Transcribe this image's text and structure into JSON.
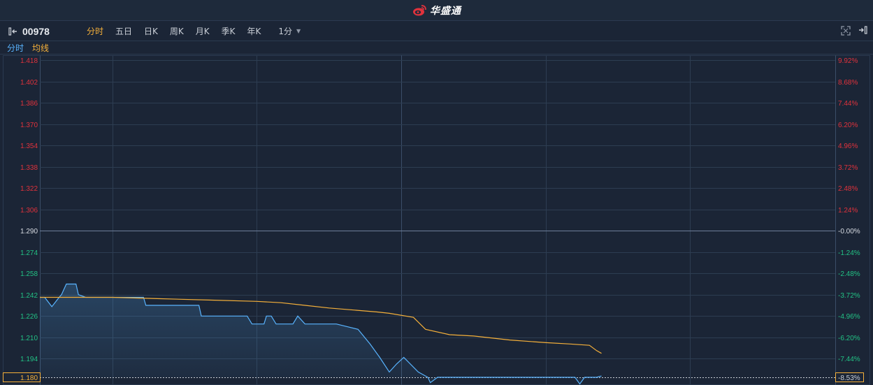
{
  "header": {
    "logo_text": "华盛通",
    "logo_icon": "sina-eye-icon"
  },
  "toolbar": {
    "stock_code": "00978",
    "tabs": [
      "分时",
      "五日",
      "日K",
      "周K",
      "月K",
      "季K",
      "年K"
    ],
    "active_tab": "分时",
    "period": "1分"
  },
  "legend": {
    "price_label": "分时",
    "avg_label": "均线"
  },
  "colors": {
    "up": "#e0323c",
    "down": "#22c285",
    "neutral": "#d8dce3",
    "price_line": "#59b4ff",
    "avg_line": "#f5b03a",
    "grid": "#2d3d52",
    "bg": "#1b2536"
  },
  "chart_data": {
    "type": "line",
    "prev_close": 1.29,
    "ylim": [
      1.18,
      1.418
    ],
    "y_ticks": [
      "1.418",
      "1.402",
      "1.386",
      "1.370",
      "1.354",
      "1.338",
      "1.322",
      "1.306",
      "1.290",
      "1.274",
      "1.258",
      "1.242",
      "1.226",
      "1.210",
      "1.194",
      "1.180"
    ],
    "pct_ticks": [
      "9.92%",
      "8.68%",
      "7.44%",
      "6.20%",
      "4.96%",
      "3.72%",
      "2.48%",
      "1.24%",
      "-0.00%",
      "-1.24%",
      "-2.48%",
      "-3.72%",
      "-4.96%",
      "-6.20%",
      "-7.44%",
      "-8.53%"
    ],
    "total_minutes": 330,
    "series": [
      {
        "key": "price",
        "points": [
          [
            0,
            1.24
          ],
          [
            2,
            1.24
          ],
          [
            5,
            1.233
          ],
          [
            8,
            1.24
          ],
          [
            9,
            1.242
          ],
          [
            11,
            1.25
          ],
          [
            15,
            1.25
          ],
          [
            16,
            1.242
          ],
          [
            19,
            1.24
          ],
          [
            37,
            1.24
          ],
          [
            43,
            1.24
          ],
          [
            44,
            1.234
          ],
          [
            55,
            1.234
          ],
          [
            66,
            1.234
          ],
          [
            67,
            1.226
          ],
          [
            86,
            1.226
          ],
          [
            88,
            1.22
          ],
          [
            93,
            1.22
          ],
          [
            94,
            1.226
          ],
          [
            96,
            1.226
          ],
          [
            98,
            1.22
          ],
          [
            105,
            1.22
          ],
          [
            107,
            1.226
          ],
          [
            110,
            1.22
          ],
          [
            123,
            1.22
          ],
          [
            132,
            1.216
          ],
          [
            137,
            1.205
          ],
          [
            141,
            1.195
          ],
          [
            145,
            1.184
          ],
          [
            148,
            1.19
          ],
          [
            151,
            1.195
          ],
          [
            157,
            1.184
          ],
          [
            161,
            1.18
          ],
          [
            162,
            1.176
          ],
          [
            165,
            1.18
          ],
          [
            222,
            1.18
          ],
          [
            224,
            1.175
          ],
          [
            226,
            1.18
          ],
          [
            231,
            1.18
          ],
          [
            233,
            1.181
          ]
        ],
        "color": "#59b4ff"
      },
      {
        "key": "avg",
        "points": [
          [
            0,
            1.24
          ],
          [
            10,
            1.24
          ],
          [
            30,
            1.24
          ],
          [
            50,
            1.239
          ],
          [
            70,
            1.238
          ],
          [
            90,
            1.237
          ],
          [
            100,
            1.236
          ],
          [
            110,
            1.234
          ],
          [
            120,
            1.232
          ],
          [
            140,
            1.229
          ],
          [
            145,
            1.228
          ],
          [
            155,
            1.225
          ],
          [
            160,
            1.216
          ],
          [
            170,
            1.212
          ],
          [
            180,
            1.211
          ],
          [
            195,
            1.208
          ],
          [
            210,
            1.206
          ],
          [
            220,
            1.205
          ],
          [
            228,
            1.204
          ],
          [
            231,
            1.2
          ],
          [
            233,
            1.198
          ]
        ],
        "color": "#f5b03a"
      }
    ]
  }
}
